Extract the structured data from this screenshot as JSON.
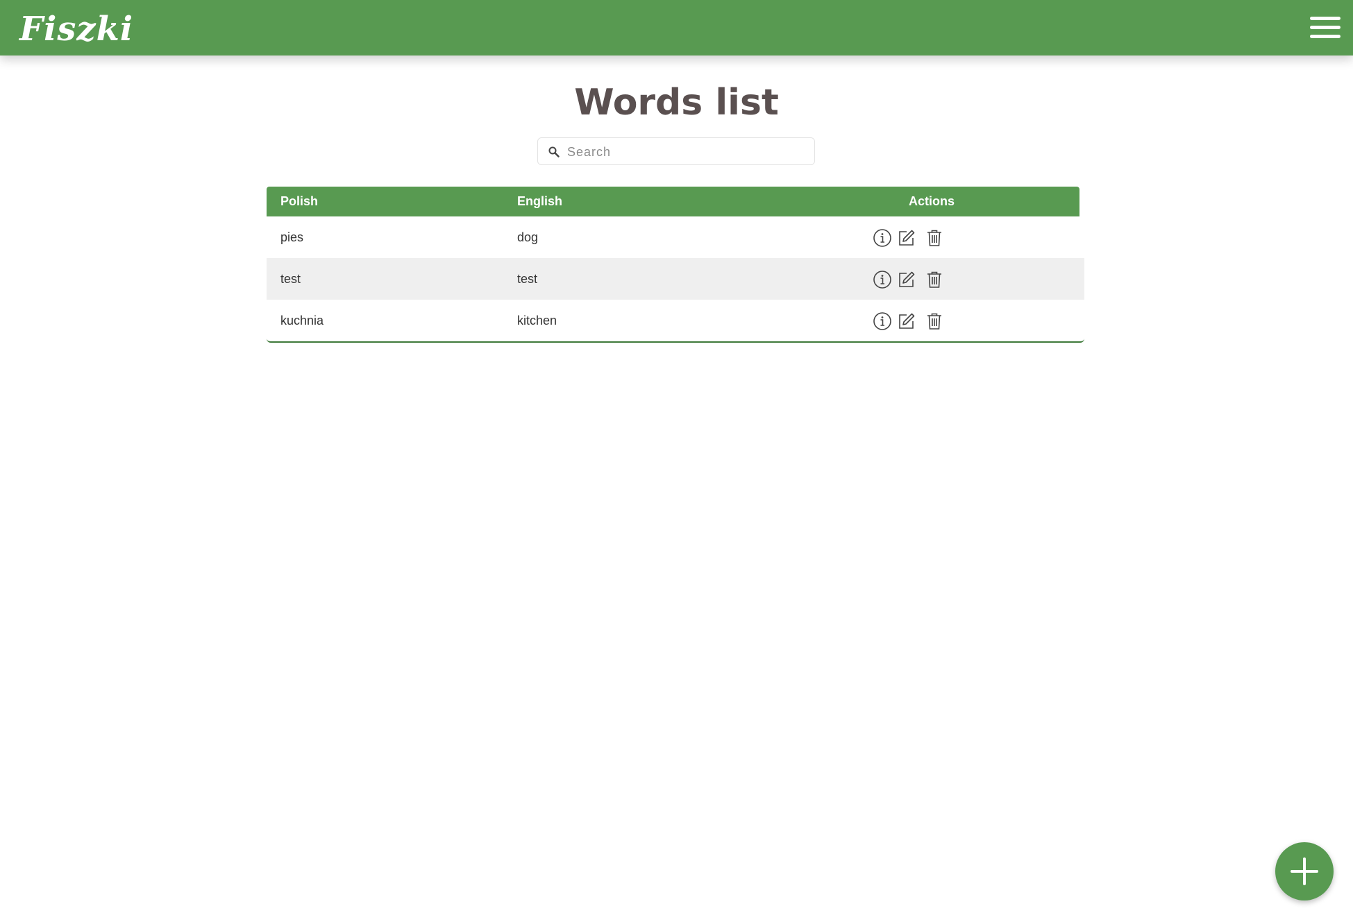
{
  "app": {
    "brand": "Fiszki",
    "brand_color": "#589a51"
  },
  "header": {
    "menu_icon": "hamburger-icon"
  },
  "page": {
    "title": "Words list"
  },
  "search": {
    "placeholder": "Search",
    "value": ""
  },
  "table": {
    "columns": {
      "polish": "Polish",
      "english": "English",
      "actions": "Actions"
    },
    "rows": [
      {
        "polish": "pies",
        "english": "dog"
      },
      {
        "polish": "test",
        "english": "test"
      },
      {
        "polish": "kuchnia",
        "english": "kitchen"
      }
    ],
    "action_icons": [
      "info-icon",
      "edit-icon",
      "trash-icon"
    ]
  },
  "fab": {
    "icon": "plus-icon"
  }
}
